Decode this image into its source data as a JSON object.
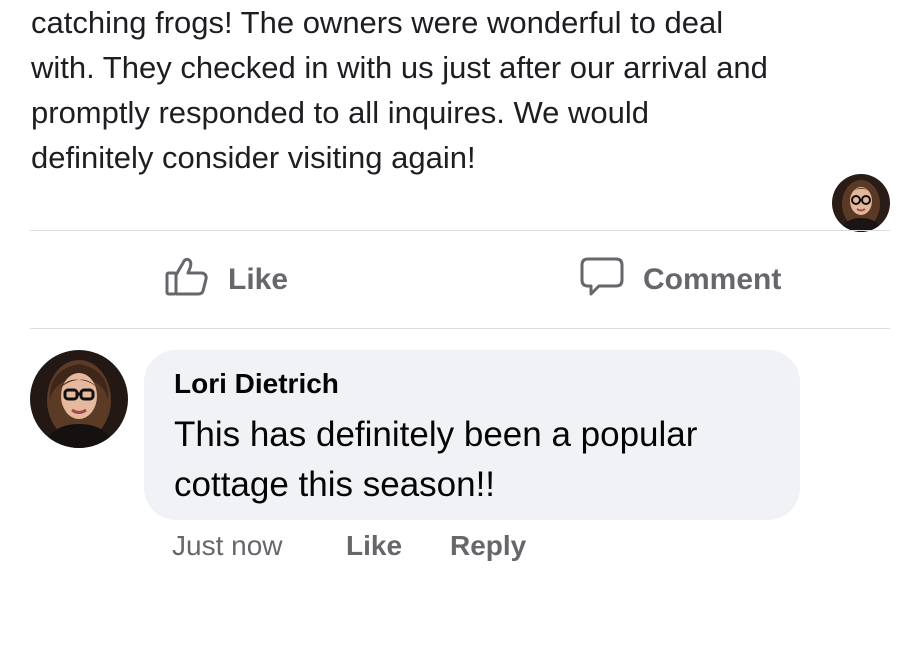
{
  "post": {
    "text_lines": [
      "catching frogs! The owners were wonderful to deal",
      "with. They checked in with us just after our arrival and",
      "promptly responded to all inquires. We would",
      "definitely consider visiting again!"
    ]
  },
  "actions": {
    "like_label": "Like",
    "comment_label": "Comment",
    "like_icon": "thumbs-up-icon",
    "comment_icon": "speech-bubble-icon"
  },
  "comment": {
    "author": "Lori Dietrich",
    "text_lines": [
      "This has definitely been a popular",
      "cottage this season!!"
    ],
    "timestamp": "Just now",
    "like_label": "Like",
    "reply_label": "Reply"
  },
  "colors": {
    "secondary_text": "#65676b",
    "bubble_bg": "#f0f2f5",
    "divider": "#dadde1"
  }
}
